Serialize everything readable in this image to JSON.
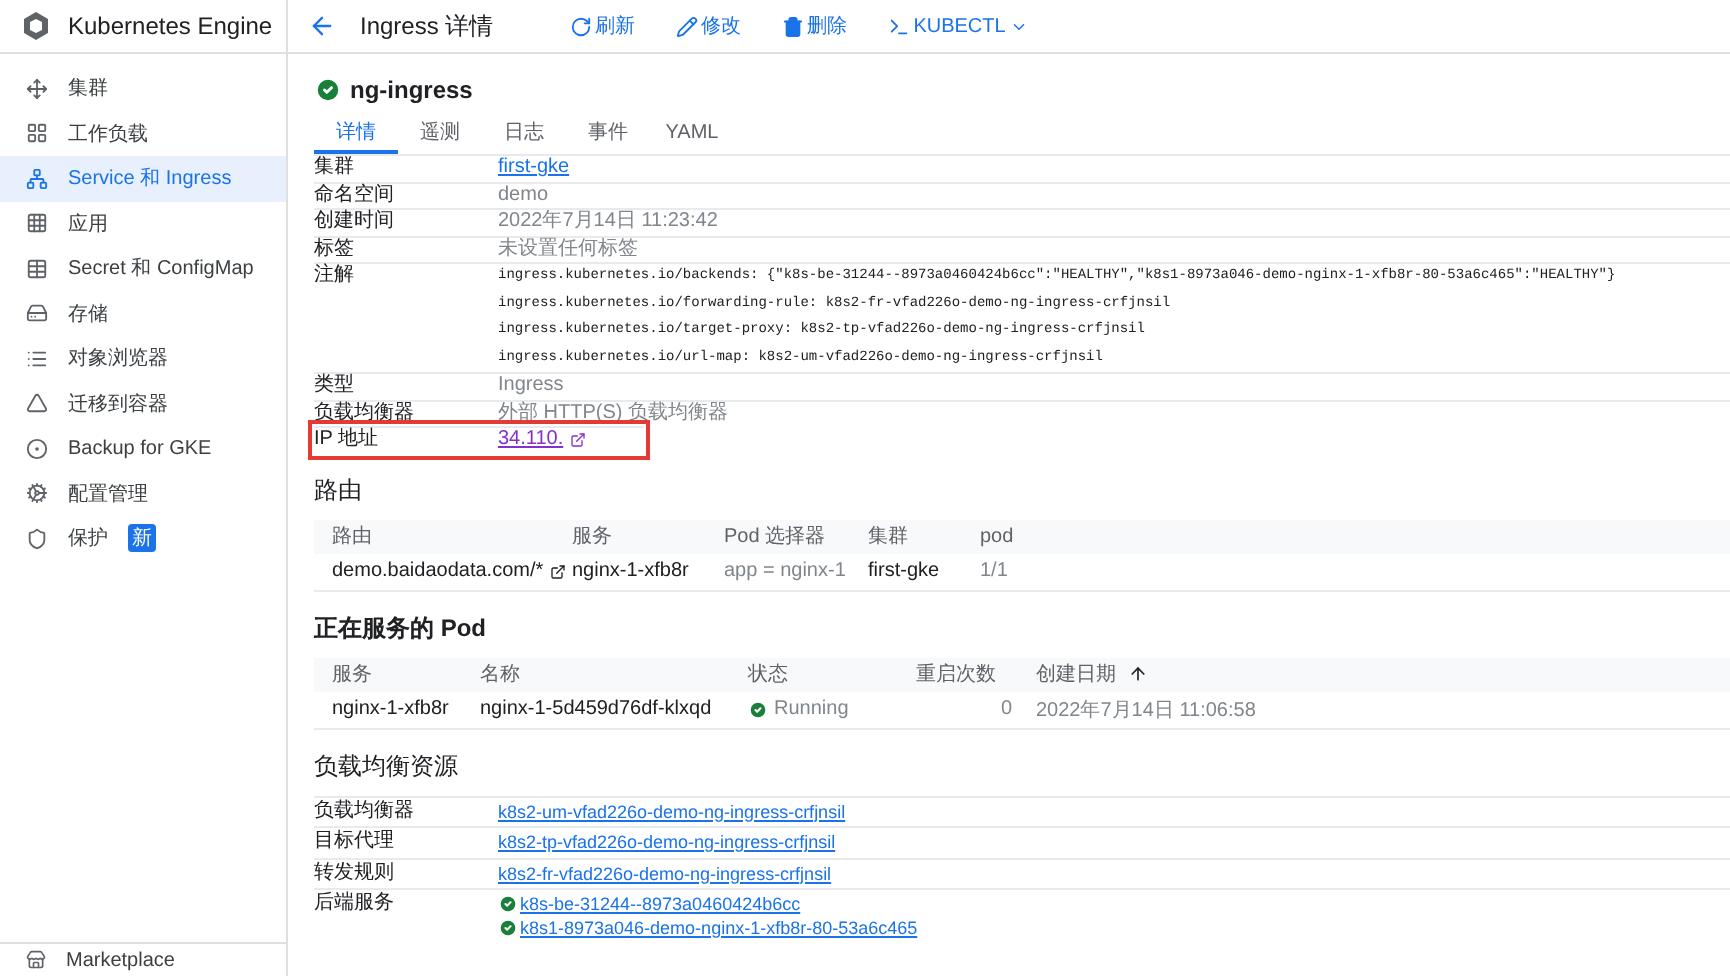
{
  "product": {
    "title": "Kubernetes Engine"
  },
  "sidebar": {
    "items": [
      {
        "label": "集群",
        "selected": false
      },
      {
        "label": "工作负载",
        "selected": false
      },
      {
        "label": "Service 和 Ingress",
        "selected": true
      },
      {
        "label": "应用",
        "selected": false
      },
      {
        "label": "Secret 和 ConfigMap",
        "selected": false
      },
      {
        "label": "存储",
        "selected": false
      },
      {
        "label": "对象浏览器",
        "selected": false
      },
      {
        "label": "迁移到容器",
        "selected": false
      },
      {
        "label": "Backup for GKE",
        "selected": false
      },
      {
        "label": "配置管理",
        "selected": false
      },
      {
        "label": "保护",
        "selected": false,
        "badge": "新"
      }
    ],
    "footer": "Marketplace"
  },
  "header": {
    "title": "Ingress 详情",
    "actions": [
      {
        "label": "刷新"
      },
      {
        "label": "修改"
      },
      {
        "label": "删除"
      },
      {
        "label": "KUBECTL",
        "dropdown": true
      }
    ]
  },
  "resource": {
    "name": "ng-ingress",
    "healthy": true
  },
  "tabs": [
    {
      "label": "详情",
      "selected": true
    },
    {
      "label": "遥测",
      "selected": false
    },
    {
      "label": "日志",
      "selected": false
    },
    {
      "label": "事件",
      "selected": false
    },
    {
      "label": "YAML",
      "selected": false
    }
  ],
  "details": [
    {
      "label": "集群",
      "kind": "link",
      "value": "first-gke"
    },
    {
      "label": "命名空间",
      "kind": "text",
      "value": "demo"
    },
    {
      "label": "创建时间",
      "kind": "text",
      "value": "2022年7月14日 11:23:42"
    },
    {
      "label": "标签",
      "kind": "text",
      "value": "未设置任何标签"
    },
    {
      "label": "注解",
      "kind": "code",
      "lines": [
        "ingress.kubernetes.io/backends: {\"k8s-be-31244--8973a0460424b6cc\":\"HEALTHY\",\"k8s1-8973a046-demo-nginx-1-xfb8r-80-53a6c465\":\"HEALTHY\"}",
        "ingress.kubernetes.io/forwarding-rule: k8s2-fr-vfad226o-demo-ng-ingress-crfjnsil",
        "ingress.kubernetes.io/target-proxy: k8s2-tp-vfad226o-demo-ng-ingress-crfjnsil",
        "ingress.kubernetes.io/url-map: k8s2-um-vfad226o-demo-ng-ingress-crfjnsil"
      ]
    },
    {
      "label": "类型",
      "kind": "text",
      "value": "Ingress"
    },
    {
      "label": "负载均衡器",
      "kind": "text",
      "value": "外部 HTTP(S) 负载均衡器"
    },
    {
      "label": "IP 地址",
      "kind": "external_link",
      "value": "34.110.",
      "highlighted": true
    }
  ],
  "routes": {
    "title": "路由",
    "columns": [
      {
        "label": "路由"
      },
      {
        "label": "服务"
      },
      {
        "label": "Pod 选择器"
      },
      {
        "label": "集群"
      },
      {
        "label": "pod"
      }
    ],
    "rows": [
      {
        "cells": [
          {
            "text": "demo.baidaodata.com/*",
            "kind": "external"
          },
          {
            "text": "nginx-1-xfb8r",
            "kind": "text"
          },
          {
            "text": "app = nginx-1",
            "kind": "muted"
          },
          {
            "text": "first-gke",
            "kind": "text"
          },
          {
            "text": "1/1",
            "kind": "muted"
          }
        ]
      }
    ]
  },
  "pods": {
    "title": "正在服务的 Pod",
    "columns": [
      {
        "label": "服务",
        "sorted": false
      },
      {
        "label": "名称",
        "sorted": false
      },
      {
        "label": "状态",
        "sorted": false
      },
      {
        "label": "重启次数",
        "sorted": false
      },
      {
        "label": "创建日期",
        "sorted": true
      }
    ],
    "rows": [
      {
        "service": "nginx-1-xfb8r",
        "name": "nginx-1-5d459d76df-klxqd",
        "status": "Running",
        "healthy": true,
        "restarts": "0",
        "created": "2022年7月14日 11:06:58"
      }
    ]
  },
  "lb": {
    "title": "负载均衡资源",
    "rows": [
      {
        "label": "负载均衡器",
        "links": [
          {
            "text": "k8s2-um-vfad226o-demo-ng-ingress-crfjnsil"
          }
        ]
      },
      {
        "label": "目标代理",
        "links": [
          {
            "text": "k8s2-tp-vfad226o-demo-ng-ingress-crfjnsil"
          }
        ]
      },
      {
        "label": "转发规则",
        "links": [
          {
            "text": "k8s2-fr-vfad226o-demo-ng-ingress-crfjnsil"
          }
        ]
      },
      {
        "label": "后端服务",
        "links": [
          {
            "text": "k8s-be-31244--8973a0460424b6cc",
            "healthy": true
          },
          {
            "text": "k8s1-8973a046-demo-nginx-1-xfb8r-80-53a6c465",
            "healthy": true
          }
        ]
      }
    ]
  }
}
